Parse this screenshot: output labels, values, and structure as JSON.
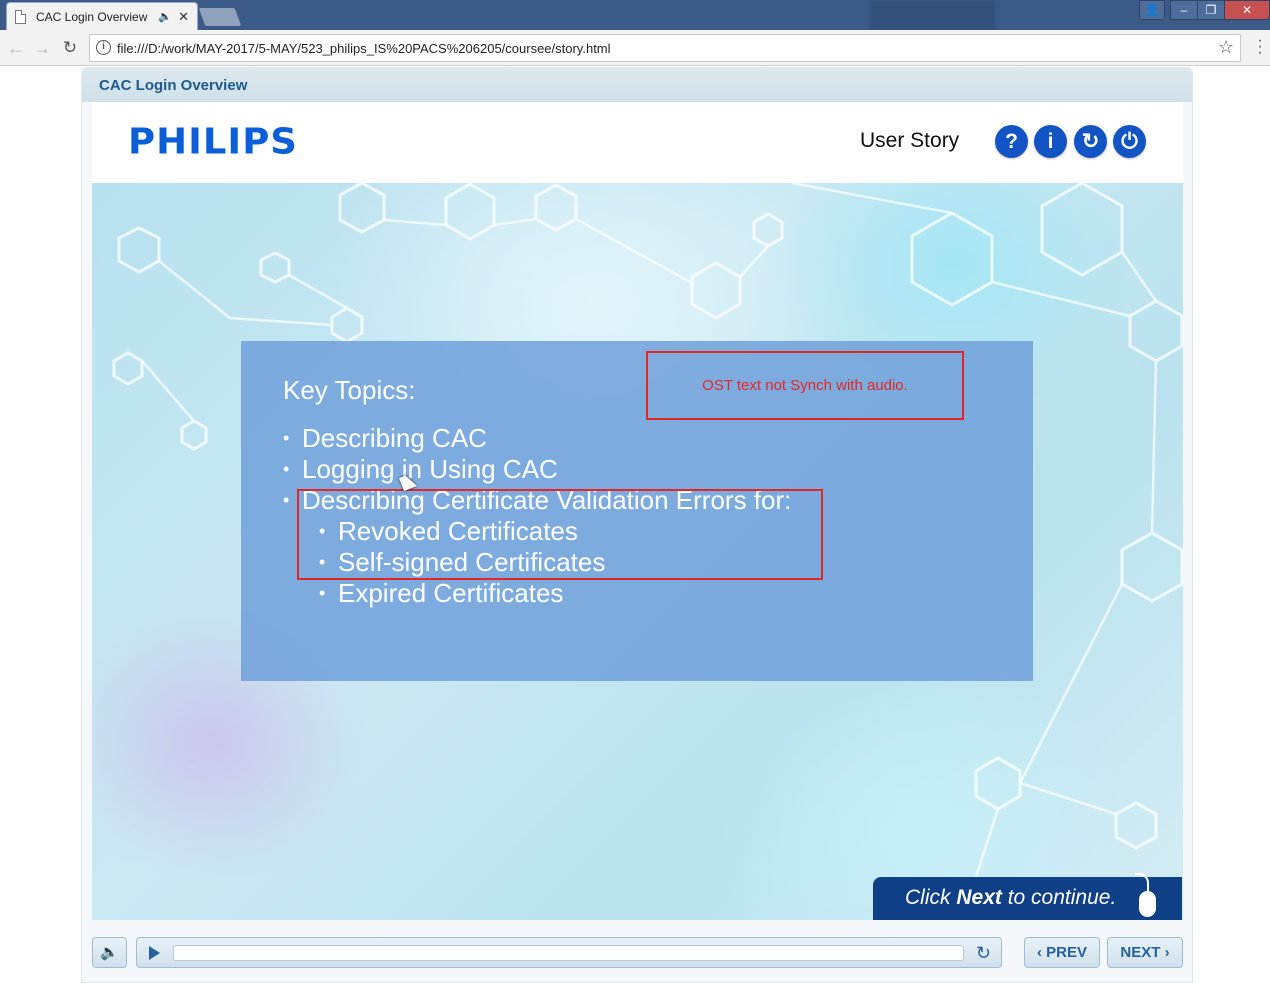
{
  "browser": {
    "tab_title": "CAC Login Overview",
    "tab_close": "✕",
    "url": "file:///D:/work/MAY-2017/5-MAY/523_philips_IS%20PACS%206205/coursee/story.html",
    "icons": {
      "back": "back-arrow-icon",
      "forward": "forward-arrow-icon",
      "reload": "reload-icon",
      "info": "info-icon",
      "bookmark": "star-icon",
      "menu": "menu-dots-icon",
      "tab_audio": "speaker-icon",
      "document": "document-icon"
    }
  },
  "player": {
    "course_title": "CAC Login Overview",
    "logo_text": "PHILIPS",
    "header_label": "User Story",
    "header_buttons": [
      {
        "symbol": "?",
        "icon": "help-icon"
      },
      {
        "symbol": "i",
        "icon": "info-icon"
      },
      {
        "symbol": "↻",
        "icon": "refresh-icon"
      },
      {
        "symbol": "⏻",
        "icon": "power-icon"
      }
    ]
  },
  "slide": {
    "heading": "Key Topics:",
    "bullets": [
      "Describing CAC",
      "Logging in Using CAC",
      "Describing Certificate Validation Errors for:"
    ],
    "sub_bullets": [
      "Revoked Certificates",
      "Self-signed Certificates",
      "Expired Certificates"
    ],
    "annotation": "OST text not Synch with audio.",
    "continue_prefix": "Click ",
    "continue_bold": "Next",
    "continue_suffix": " to continue."
  },
  "controls": {
    "prev_label": "PREV",
    "next_label": "NEXT",
    "progress": 0
  },
  "colors": {
    "brand_blue": "#0b5ed7",
    "icon_blue": "#1254c4",
    "annotation_red": "#e32626",
    "content_box": "#70a0da",
    "continue_bar": "#0f3f86"
  }
}
